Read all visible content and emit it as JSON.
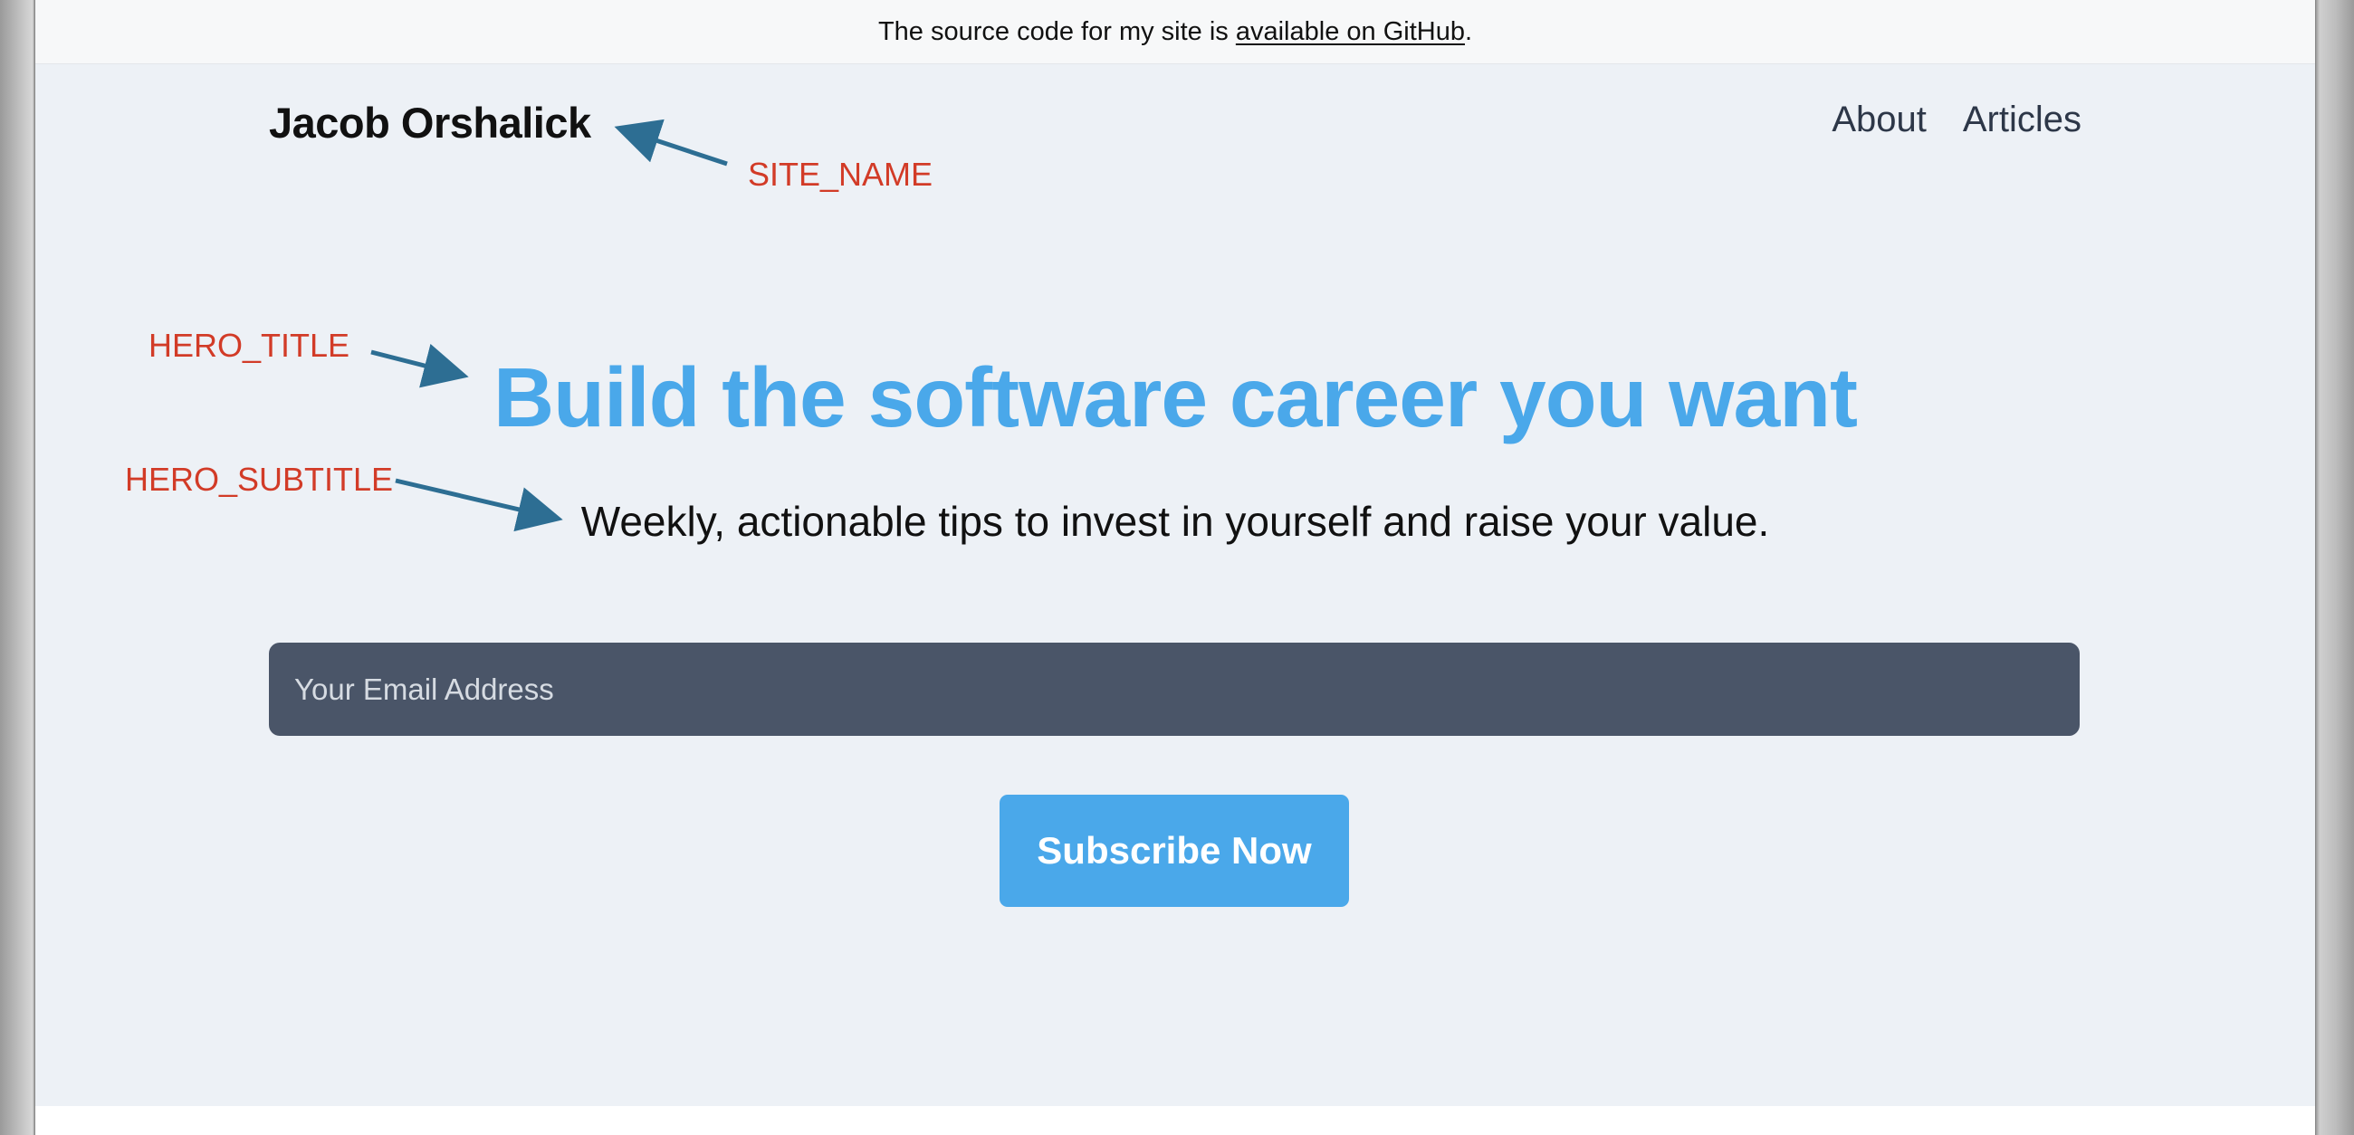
{
  "banner": {
    "text_before": "The source code for my site is ",
    "link_text": "available on GitHub",
    "text_after": "."
  },
  "header": {
    "site_name": "Jacob Orshalick",
    "nav": [
      {
        "label": "About"
      },
      {
        "label": "Articles"
      }
    ]
  },
  "hero": {
    "title": "Build the software career you want",
    "subtitle": "Weekly, actionable tips to invest in yourself and raise your value."
  },
  "subscribe": {
    "email_placeholder": "Your Email Address",
    "button_label": "Subscribe Now"
  },
  "annotations": {
    "site_name": "SITE_NAME",
    "hero_title": "HERO_TITLE",
    "hero_subtitle": "HERO_SUBTITLE",
    "color": "#d23b27",
    "arrow_color": "#2d6e93"
  },
  "colors": {
    "accent": "#4aa8ea",
    "page_background": "#edf1f6",
    "input_background": "#4a5568"
  }
}
